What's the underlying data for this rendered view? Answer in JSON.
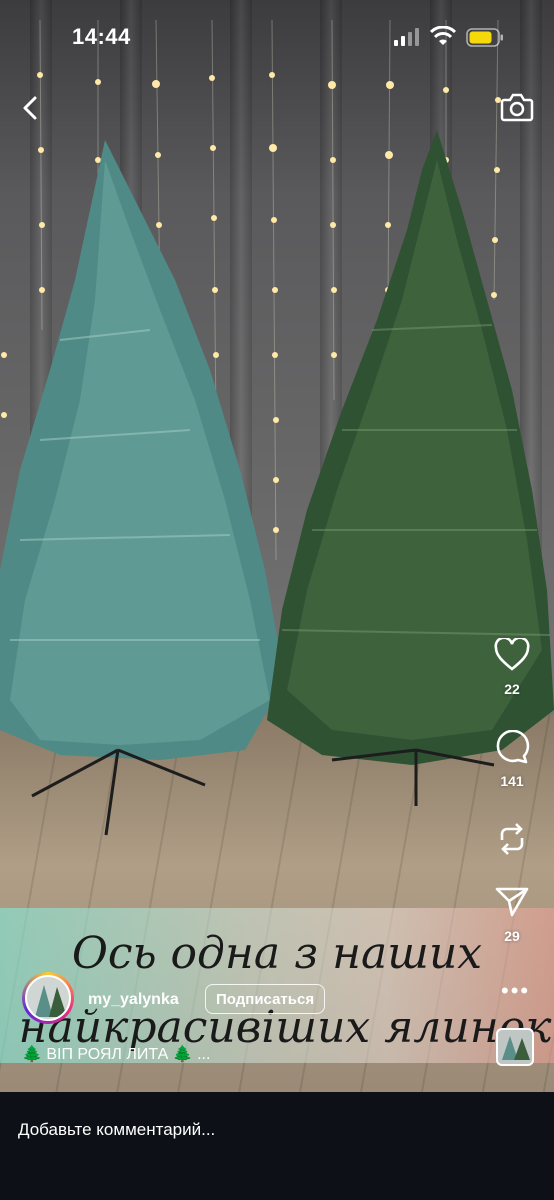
{
  "status_bar": {
    "time": "14:44"
  },
  "post": {
    "username": "my_yalynka",
    "follow_label": "Подписаться",
    "caption_line1": "Ось одна з наших",
    "caption_line2": "найкрасивіших ялинок",
    "audio_label": "🌲 ВІП РОЯЛ ЛИТА 🌲 ..."
  },
  "actions": {
    "likes": "22",
    "comments": "141",
    "shares": "29"
  },
  "comment_bar": {
    "placeholder": "Добавьте комментарий..."
  },
  "icons": {
    "back": "chevron-left-icon",
    "camera": "camera-icon",
    "like": "heart-icon",
    "comment": "comment-bubble-icon",
    "remix": "repost-icon",
    "share": "paper-plane-icon",
    "more": "ellipsis-icon"
  },
  "colors": {
    "battery": "#f5d90a",
    "comment_bar_bg": "#0d1117"
  }
}
